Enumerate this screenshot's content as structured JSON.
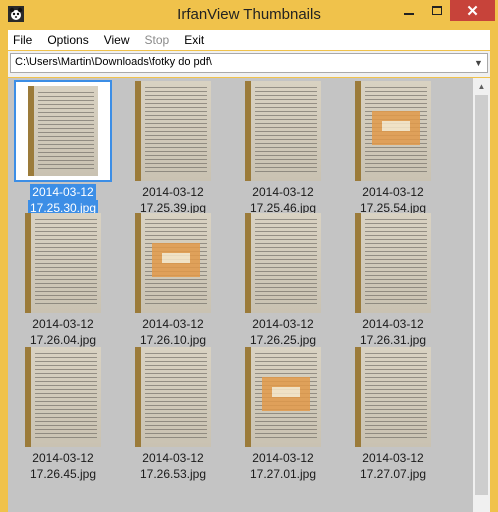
{
  "window": {
    "title": "IrfanView Thumbnails",
    "close_glyph": "✕",
    "controls": [
      "minimize-icon",
      "maximize-icon",
      "close-icon"
    ]
  },
  "menu": {
    "items": [
      {
        "label": "File",
        "enabled": true
      },
      {
        "label": "Options",
        "enabled": true
      },
      {
        "label": "View",
        "enabled": true
      },
      {
        "label": "Stop",
        "enabled": false
      },
      {
        "label": "Exit",
        "enabled": true
      }
    ]
  },
  "pathbar": {
    "value": "C:\\Users\\Martin\\Downloads\\fotky do pdf\\",
    "dropdown_glyph": "▼"
  },
  "scrollbar": {
    "up_glyph": "▲"
  },
  "thumbnails": [
    {
      "date": "2014-03-12",
      "time": "17.25.30.jpg",
      "selected": true,
      "has_figure": false
    },
    {
      "date": "2014-03-12",
      "time": "17.25.39.jpg",
      "selected": false,
      "has_figure": false
    },
    {
      "date": "2014-03-12",
      "time": "17.25.46.jpg",
      "selected": false,
      "has_figure": false
    },
    {
      "date": "2014-03-12",
      "time": "17.25.54.jpg",
      "selected": false,
      "has_figure": true
    },
    {
      "date": "2014-03-12",
      "time": "17.26.04.jpg",
      "selected": false,
      "has_figure": false
    },
    {
      "date": "2014-03-12",
      "time": "17.26.10.jpg",
      "selected": false,
      "has_figure": true
    },
    {
      "date": "2014-03-12",
      "time": "17.26.25.jpg",
      "selected": false,
      "has_figure": false
    },
    {
      "date": "2014-03-12",
      "time": "17.26.31.jpg",
      "selected": false,
      "has_figure": false
    },
    {
      "date": "2014-03-12",
      "time": "17.26.45.jpg",
      "selected": false,
      "has_figure": false
    },
    {
      "date": "2014-03-12",
      "time": "17.26.53.jpg",
      "selected": false,
      "has_figure": false
    },
    {
      "date": "2014-03-12",
      "time": "17.27.01.jpg",
      "selected": false,
      "has_figure": true
    },
    {
      "date": "2014-03-12",
      "time": "17.27.07.jpg",
      "selected": false,
      "has_figure": false
    }
  ],
  "colors": {
    "titlebar": "#f0c24b",
    "selection": "#3c8ee6",
    "close_button": "#c7433a",
    "content_bg": "#c4c4c4"
  }
}
